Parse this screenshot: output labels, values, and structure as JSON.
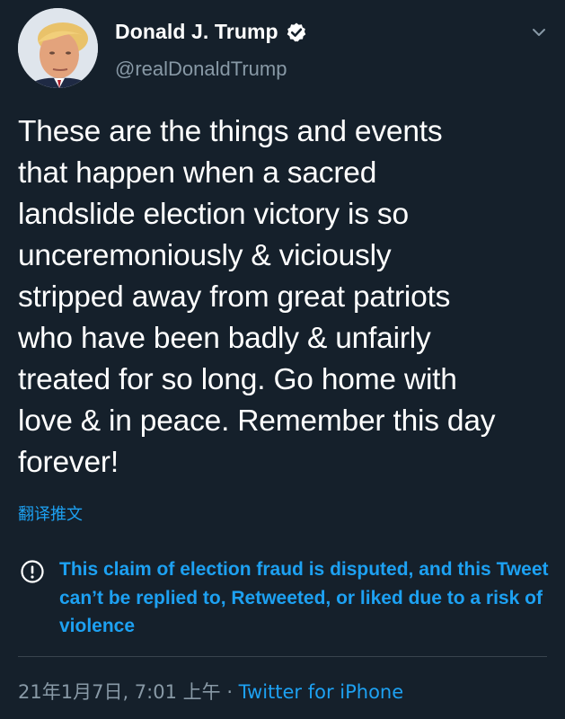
{
  "author": {
    "display_name": "Donald J. Trump",
    "handle": "@realDonaldTrump",
    "avatar_icon": "profile-photo",
    "verified_icon": "verified-badge-icon"
  },
  "tweet": {
    "text": "These are the things and events\nthat happen when a sacred\nlandslide election victory is so\nunceremoniously & viciously\nstripped away from great patriots\nwho have been badly & unfairly\ntreated for so long. Go home with\nlove & in peace. Remember this day\nforever!",
    "translate_label": "翻译推文"
  },
  "notice": {
    "icon": "exclamation-circle-icon",
    "text": "This claim of election fraud is disputed, and this Tweet can’t be replied to, Retweeted, or liked due to a risk of violence"
  },
  "meta": {
    "timestamp": "21年1月7日, 7:01 上午",
    "separator": " · ",
    "source": "Twitter for iPhone"
  },
  "colors": {
    "background": "#15202b",
    "link": "#1da1f2",
    "secondary_text": "#8899a6",
    "divider": "#38444d"
  }
}
